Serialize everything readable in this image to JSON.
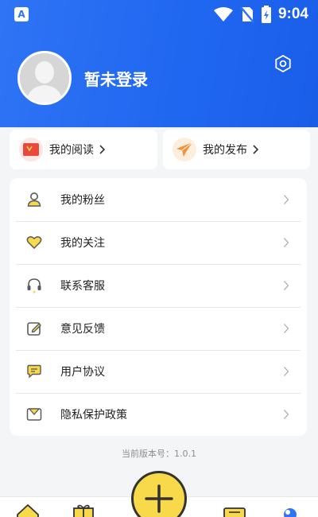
{
  "status_bar": {
    "time": "9:04",
    "left_icon": "A"
  },
  "profile": {
    "username": "暂未登录"
  },
  "quick_actions": [
    {
      "label": "我的阅读",
      "icon": "red-envelope-icon",
      "color": "#e8493c"
    },
    {
      "label": "我的发布",
      "icon": "paper-plane-icon",
      "color": "#f58f3a"
    }
  ],
  "menu": {
    "items": [
      {
        "label": "我的粉丝",
        "icon": "user-icon"
      },
      {
        "label": "我的关注",
        "icon": "heart-icon"
      },
      {
        "label": "联系客服",
        "icon": "headset-icon"
      },
      {
        "label": "意见反馈",
        "icon": "edit-icon"
      },
      {
        "label": "用户协议",
        "icon": "chat-icon"
      },
      {
        "label": "隐私保护政策",
        "icon": "privacy-icon"
      }
    ]
  },
  "version_text": "当前版本号：1.0.1",
  "colors": {
    "header_blue": "#2f74f5",
    "accent_yellow": "#f7d94a",
    "icon_dark": "#5a5a5a"
  }
}
